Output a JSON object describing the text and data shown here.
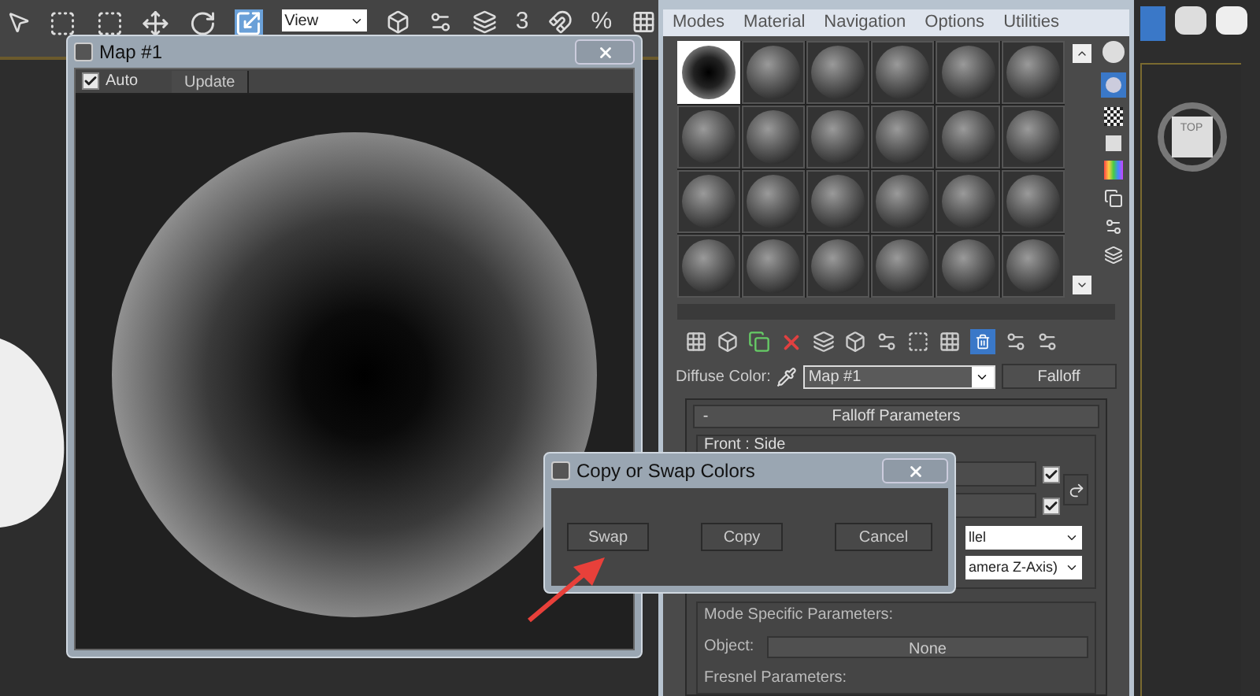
{
  "toolbar": {
    "view_dropdown": "View",
    "snap_label": "3",
    "percent_label": "%"
  },
  "map_window": {
    "title": "Map #1",
    "auto": {
      "label": "Auto",
      "checked": true
    },
    "update_button": "Update"
  },
  "material_editor": {
    "menu": [
      "Modes",
      "Material",
      "Navigation",
      "Options",
      "Utilities"
    ],
    "slots": [
      {
        "selected": true
      },
      {
        "selected": false
      },
      {
        "selected": false
      },
      {
        "selected": false
      },
      {
        "selected": false
      },
      {
        "selected": false
      },
      {
        "selected": false
      },
      {
        "selected": false
      },
      {
        "selected": false
      },
      {
        "selected": false
      },
      {
        "selected": false
      },
      {
        "selected": false
      },
      {
        "selected": false
      },
      {
        "selected": false
      },
      {
        "selected": false
      },
      {
        "selected": false
      },
      {
        "selected": false
      },
      {
        "selected": false
      },
      {
        "selected": false
      },
      {
        "selected": false
      },
      {
        "selected": false
      },
      {
        "selected": false
      },
      {
        "selected": false
      },
      {
        "selected": false
      }
    ],
    "diffuse_label": "Diffuse Color:",
    "map_dropdown": "Map #1",
    "map_type_button": "Falloff",
    "rollout": {
      "collapse": "-",
      "title": "Falloff Parameters"
    },
    "front_side_label": "Front : Side",
    "color_rows": [
      {
        "checked": true
      },
      {
        "checked": true
      }
    ],
    "falloff_type": "llel",
    "falloff_direction": "amera Z-Axis)",
    "mode_specific_label": "Mode Specific Parameters:",
    "object_label": "Object:",
    "object_button": "None",
    "fresnel_label": "Fresnel Parameters:"
  },
  "viewcube": {
    "label": "TOP"
  },
  "dialog": {
    "title": "Copy or Swap Colors",
    "buttons": [
      "Swap",
      "Copy",
      "Cancel"
    ]
  }
}
